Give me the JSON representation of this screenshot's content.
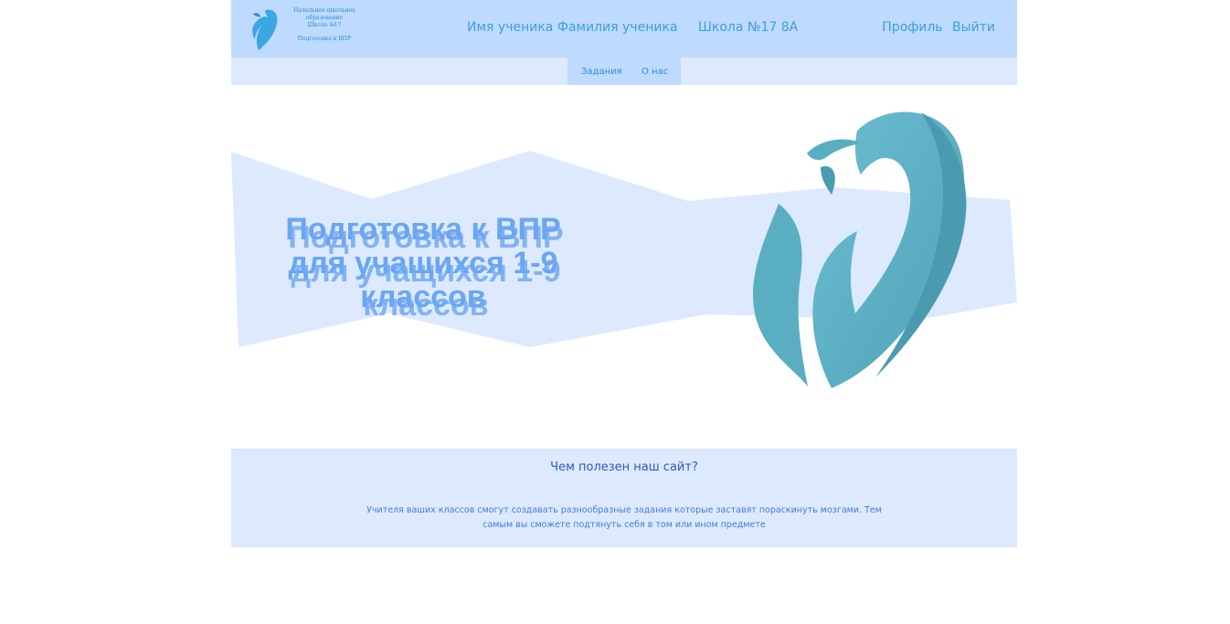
{
  "header": {
    "logo": {
      "line1": "Начальное школьное",
      "line2": "образование",
      "line3": "Школа №17",
      "subtitle": "Подготовка к ВПР"
    },
    "student_name": "Имя ученика Фамилия ученика",
    "school": "Школа №17 8А",
    "profile_label": "Профиль",
    "logout_label": "Выйти"
  },
  "nav": {
    "tasks_label": "Задания",
    "about_label": "О нас"
  },
  "hero": {
    "title_line1": "Подготовка к ВПР",
    "title_line2": "для учащихся 1-9",
    "title_line3": "классов"
  },
  "info": {
    "title": "Чем полезен наш сайт?",
    "text": "Учителя ваших классов смогут создавать разнообразные задания которые заставят пораскинуть мозгами. Тем самым вы сможете подтянуть себя в том или ином предмете"
  },
  "colors": {
    "header_bg": "#bedaff",
    "nav_bg": "#dce9ff",
    "accent": "#3aa0e0",
    "hero_title": "#6aa6f2",
    "logo_teal": "#5fb4c8"
  }
}
